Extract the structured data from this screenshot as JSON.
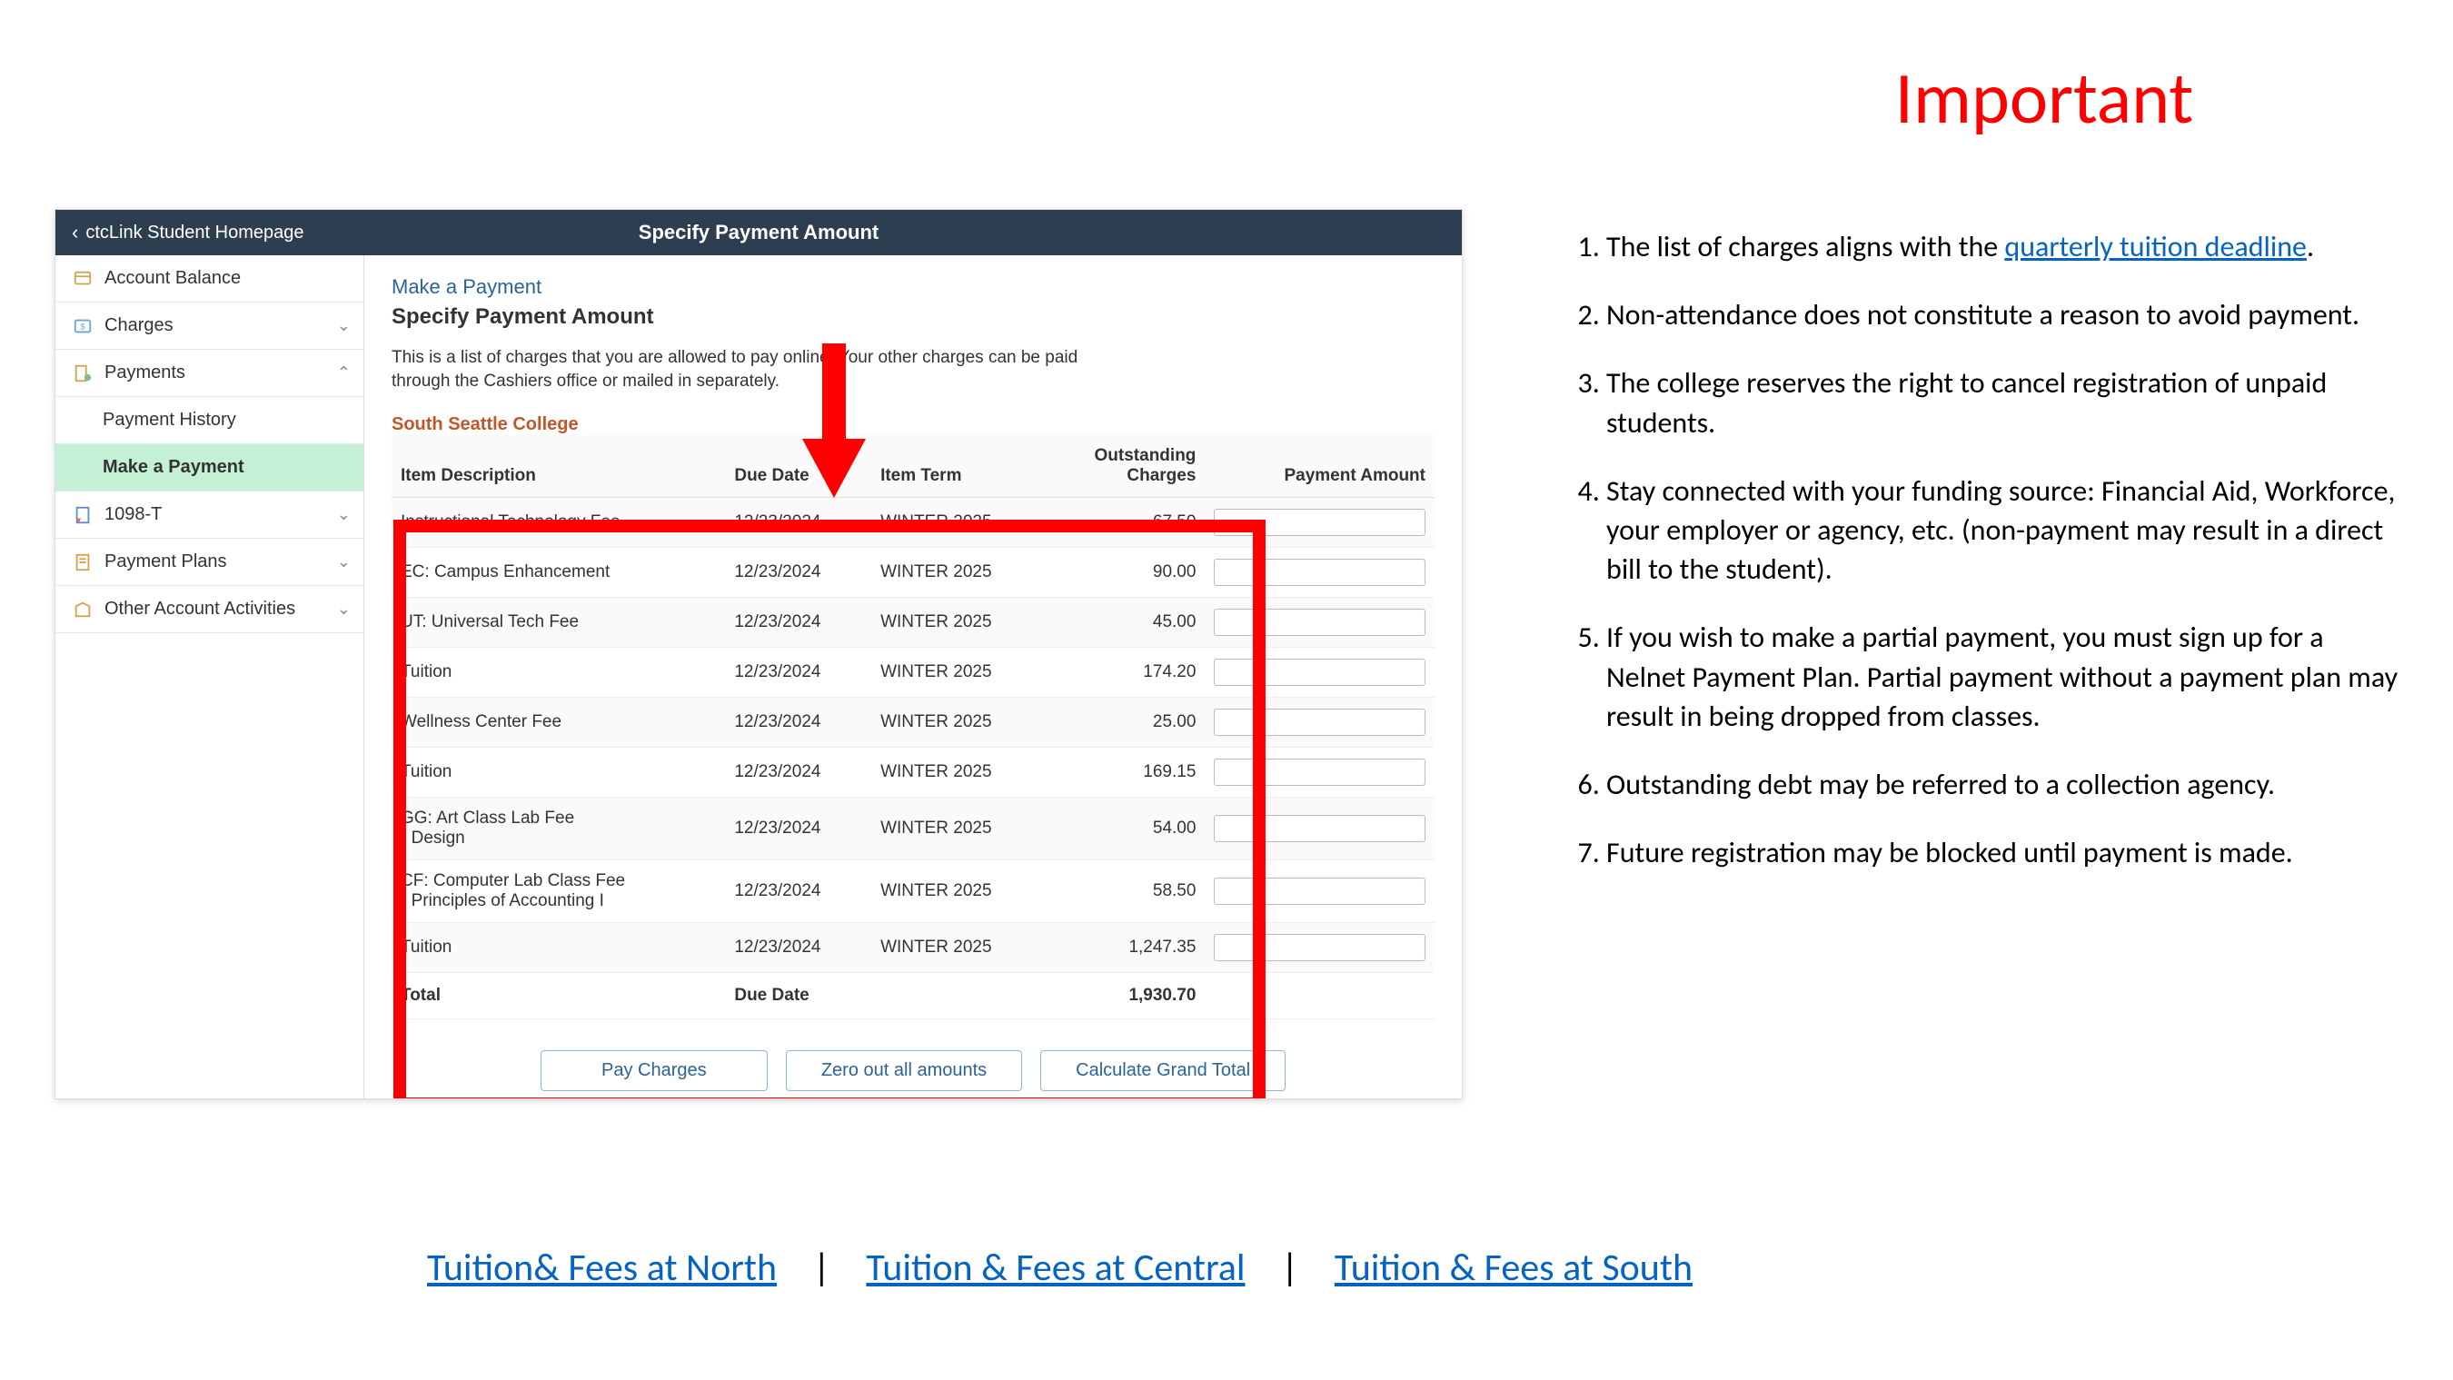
{
  "slide": {
    "title": "Important",
    "notes": [
      {
        "pre": "The list of charges aligns with the ",
        "link": "quarterly tuition deadline",
        "post": "."
      },
      {
        "text": "Non-attendance does not constitute a reason to avoid payment."
      },
      {
        "text": "The college reserves the right to cancel registration of unpaid students."
      },
      {
        "text": "Stay connected with your funding source: Financial Aid, Workforce, your employer or agency, etc. (non-payment may result in a direct bill to the student)."
      },
      {
        "text": "If you wish to make a partial payment, you must sign up for a Nelnet Payment Plan. Partial payment without a payment plan may result in being dropped from classes."
      },
      {
        "text": "Outstanding debt may be referred to a collection agency."
      },
      {
        "text": "Future registration may be blocked until payment is made."
      }
    ],
    "footer_links": {
      "north": "Tuition& Fees at North",
      "central": " Tuition & Fees at Central",
      "south": "Tuition & Fees at South",
      "separator": "|"
    }
  },
  "app": {
    "header": {
      "back_label": "ctcLink Student Homepage",
      "title": "Specify Payment Amount"
    },
    "sidebar": {
      "items": [
        {
          "label": "Account Balance",
          "expandable": false
        },
        {
          "label": "Charges",
          "expandable": true,
          "state": "collapsed"
        },
        {
          "label": "Payments",
          "expandable": true,
          "state": "expanded"
        },
        {
          "label": "Payment History",
          "sub": true
        },
        {
          "label": "Make a Payment",
          "sub": true,
          "active": true
        },
        {
          "label": "1098-T",
          "expandable": true,
          "state": "collapsed"
        },
        {
          "label": "Payment Plans",
          "expandable": true,
          "state": "collapsed"
        },
        {
          "label": "Other Account Activities",
          "expandable": true,
          "state": "collapsed"
        }
      ]
    },
    "main": {
      "breadcrumb_link": "Make a Payment",
      "heading": "Specify Payment Amount",
      "intro": "This is a list of charges that you are allowed to pay online. Your other charges can be paid through the Cashiers office or mailed in separately.",
      "college": "South Seattle College",
      "columns": {
        "desc": "Item Description",
        "due": "Due Date",
        "term": "Item Term",
        "outstanding": "Outstanding Charges",
        "payment": "Payment Amount"
      },
      "rows": [
        {
          "desc": "Instructional Technology Fee",
          "due": "12/23/2024",
          "term": "WINTER 2025",
          "outstanding": "67.50"
        },
        {
          "desc": "EC: Campus Enhancement",
          "due": "12/23/2024",
          "term": "WINTER 2025",
          "outstanding": "90.00"
        },
        {
          "desc": "UT: Universal Tech Fee",
          "due": "12/23/2024",
          "term": "WINTER 2025",
          "outstanding": "45.00"
        },
        {
          "desc": "Tuition",
          "due": "12/23/2024",
          "term": "WINTER 2025",
          "outstanding": "174.20"
        },
        {
          "desc": "Wellness Center Fee",
          "due": "12/23/2024",
          "term": "WINTER 2025",
          "outstanding": "25.00"
        },
        {
          "desc": "Tuition",
          "due": "12/23/2024",
          "term": "WINTER 2025",
          "outstanding": "169.15"
        },
        {
          "desc": "GG: Art Class Lab Fee\n-  Design",
          "due": "12/23/2024",
          "term": "WINTER 2025",
          "outstanding": "54.00"
        },
        {
          "desc": "CF: Computer Lab Class Fee\n-  Principles of Accounting I",
          "due": "12/23/2024",
          "term": "WINTER 2025",
          "outstanding": "58.50"
        },
        {
          "desc": "Tuition",
          "due": "12/23/2024",
          "term": "WINTER 2025",
          "outstanding": "1,247.35"
        }
      ],
      "total_row": {
        "label": "Total",
        "due_label": "Due Date",
        "amount": "1,930.70"
      },
      "buttons": {
        "pay": "Pay Charges",
        "zero": "Zero out all amounts",
        "calc": "Calculate Grand Total"
      }
    }
  }
}
